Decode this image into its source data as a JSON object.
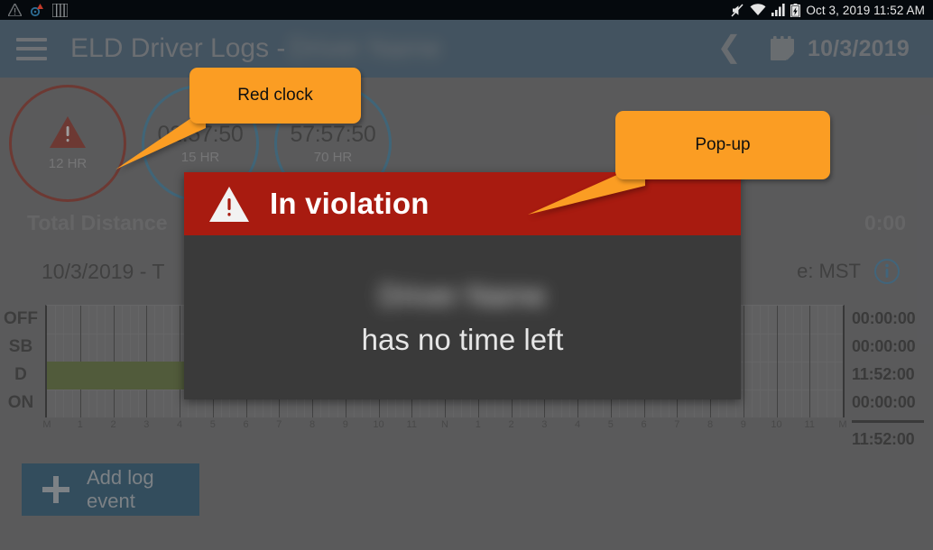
{
  "statusbar": {
    "left_icons": [
      "warning-triangle-icon",
      "gear-alert-icon",
      "sim-bars-icon"
    ],
    "right_icons": [
      "mute-icon",
      "wifi-icon",
      "cell-signal-icon",
      "battery-charging-icon"
    ],
    "datetime": "Oct 3, 2019 11:52 AM"
  },
  "appbar": {
    "menu_icon": "hamburger-menu-icon",
    "title": "ELD Driver Logs -",
    "driver_name": "Driver Name",
    "back_icon": "chevron-left-icon",
    "calendar_icon": "calendar-icon",
    "date": "10/3/2019"
  },
  "clocks": [
    {
      "name": "break-clock",
      "value": "",
      "limit": "12 HR",
      "state": "violation",
      "color": "#7c1e13",
      "icon": "warning-triangle-icon"
    },
    {
      "name": "driving-clock",
      "value": "02:57:50",
      "limit": "15 HR",
      "state": "ok",
      "color": "#2a6e90",
      "icon": ""
    },
    {
      "name": "cycle-clock",
      "value": "57:57:50",
      "limit": "70 HR",
      "state": "ok",
      "color": "#2a6e90",
      "icon": ""
    }
  ],
  "distance_row": {
    "label": "Total Distance",
    "value": "0:00"
  },
  "tz_row": {
    "date_line": "10/3/2019 - T",
    "tz_line": "e: MST",
    "info_icon": "info-icon"
  },
  "graph": {
    "row_labels": [
      "OFF",
      "SB",
      "D",
      "ON"
    ],
    "axis_ticks": [
      "M",
      "1",
      "2",
      "3",
      "4",
      "5",
      "6",
      "7",
      "8",
      "9",
      "10",
      "11",
      "N",
      "1",
      "2",
      "3",
      "4",
      "5",
      "6",
      "7",
      "8",
      "9",
      "10",
      "11",
      "M"
    ],
    "segments": [
      {
        "status": "D",
        "start_hour": 0,
        "end_hour": 4.13,
        "color": "#495c22"
      }
    ],
    "violation_region": {
      "start_hour": 4.13,
      "end_hour": 11.87,
      "color": "#3a3a3a",
      "border": "#b32018"
    }
  },
  "totals": {
    "rows": [
      "00:00:00",
      "00:00:00",
      "11:52:00",
      "00:00:00"
    ],
    "grand": "11:52:00"
  },
  "add_button": {
    "icon": "plus-icon",
    "label": "Add log event"
  },
  "dialog": {
    "icon": "warning-triangle-icon",
    "title": "In violation",
    "driver_name": "Driver Name",
    "message": "has no time left"
  },
  "annotations": [
    {
      "name": "callout-red-clock",
      "text": "Red clock"
    },
    {
      "name": "callout-popup",
      "text": "Pop-up"
    }
  ],
  "colors": {
    "appbar": "#14456a",
    "accent_orange": "#fb9d23",
    "violation_red": "#a81b10",
    "drive_green": "#495c22",
    "clock_blue": "#2a6e90",
    "clock_red": "#7c1e13"
  }
}
